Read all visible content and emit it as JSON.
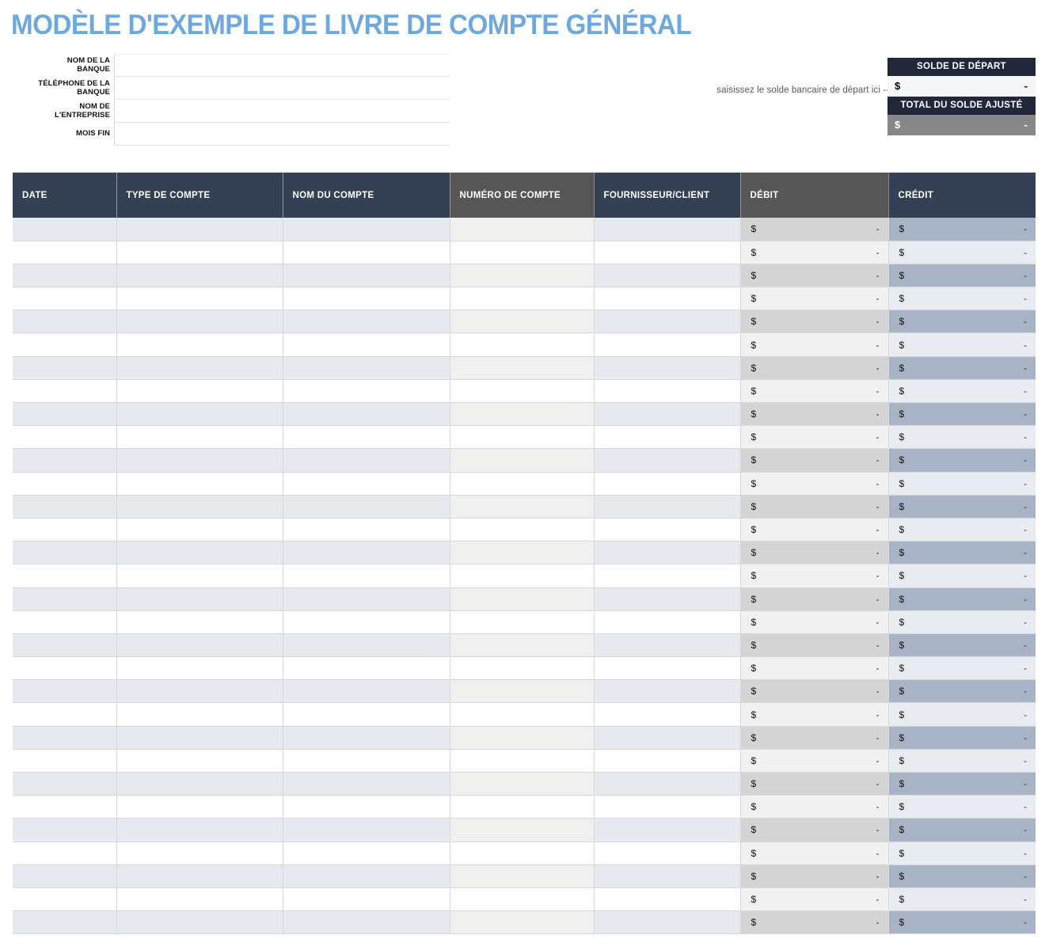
{
  "title": "MODÈLE D'EXEMPLE DE LIVRE DE COMPTE GÉNÉRAL",
  "colors": {
    "title_blue": "#6FA8DC",
    "header_navy": "#344154",
    "header_grey": "#565656",
    "balance_navy": "#22283a",
    "credit_shade": "#a8b4c6",
    "debit_shade": "#d4d4d4",
    "row_shade": "#e6eaef"
  },
  "form": {
    "fields": [
      {
        "label_line1": "NOM DE LA",
        "label_line2": "BANQUE",
        "value": "",
        "placeholder": ""
      },
      {
        "label_line1": "TÉLÉPHONE DE LA",
        "label_line2": "BANQUE",
        "value": "",
        "placeholder": ""
      },
      {
        "label_line1": "NOM DE",
        "label_line2": "L'ENTREPRISE",
        "value": "",
        "placeholder": ""
      },
      {
        "label_line1": "MOIS FIN",
        "label_line2": "",
        "value": "",
        "placeholder": ""
      }
    ]
  },
  "balance": {
    "note": "saisissez le solde bancaire de départ ici -->",
    "starting_label": "SOLDE DE DÉPART",
    "starting_currency": "$",
    "starting_value": "-",
    "adjusted_label": "TOTAL DU SOLDE AJUSTÉ",
    "adjusted_currency": "$",
    "adjusted_value": "-"
  },
  "table": {
    "columns": [
      {
        "label": "DATE",
        "style": "navy",
        "type": "plain"
      },
      {
        "label": "TYPE DE COMPTE",
        "style": "navy",
        "type": "plain"
      },
      {
        "label": "NOM DU COMPTE",
        "style": "navy",
        "type": "plain"
      },
      {
        "label": "NUMÉRO DE COMPTE",
        "style": "grey",
        "type": "acctnum"
      },
      {
        "label": "FOURNISSEUR/CLIENT",
        "style": "navy",
        "type": "plain"
      },
      {
        "label": "DÉBIT",
        "style": "grey",
        "type": "debit"
      },
      {
        "label": "CRÉDIT",
        "style": "navy",
        "type": "credit"
      }
    ],
    "row_count": 31,
    "currency_symbol": "$",
    "empty_value": "-",
    "rows": [
      {
        "date": "",
        "account_type": "",
        "account_name": "",
        "account_number": "",
        "vendor_customer": "",
        "debit": "-",
        "credit": "-"
      },
      {
        "date": "",
        "account_type": "",
        "account_name": "",
        "account_number": "",
        "vendor_customer": "",
        "debit": "-",
        "credit": "-"
      },
      {
        "date": "",
        "account_type": "",
        "account_name": "",
        "account_number": "",
        "vendor_customer": "",
        "debit": "-",
        "credit": "-"
      },
      {
        "date": "",
        "account_type": "",
        "account_name": "",
        "account_number": "",
        "vendor_customer": "",
        "debit": "-",
        "credit": "-"
      },
      {
        "date": "",
        "account_type": "",
        "account_name": "",
        "account_number": "",
        "vendor_customer": "",
        "debit": "-",
        "credit": "-"
      },
      {
        "date": "",
        "account_type": "",
        "account_name": "",
        "account_number": "",
        "vendor_customer": "",
        "debit": "-",
        "credit": "-"
      },
      {
        "date": "",
        "account_type": "",
        "account_name": "",
        "account_number": "",
        "vendor_customer": "",
        "debit": "-",
        "credit": "-"
      },
      {
        "date": "",
        "account_type": "",
        "account_name": "",
        "account_number": "",
        "vendor_customer": "",
        "debit": "-",
        "credit": "-"
      },
      {
        "date": "",
        "account_type": "",
        "account_name": "",
        "account_number": "",
        "vendor_customer": "",
        "debit": "-",
        "credit": "-"
      },
      {
        "date": "",
        "account_type": "",
        "account_name": "",
        "account_number": "",
        "vendor_customer": "",
        "debit": "-",
        "credit": "-"
      },
      {
        "date": "",
        "account_type": "",
        "account_name": "",
        "account_number": "",
        "vendor_customer": "",
        "debit": "-",
        "credit": "-"
      },
      {
        "date": "",
        "account_type": "",
        "account_name": "",
        "account_number": "",
        "vendor_customer": "",
        "debit": "-",
        "credit": "-"
      },
      {
        "date": "",
        "account_type": "",
        "account_name": "",
        "account_number": "",
        "vendor_customer": "",
        "debit": "-",
        "credit": "-"
      },
      {
        "date": "",
        "account_type": "",
        "account_name": "",
        "account_number": "",
        "vendor_customer": "",
        "debit": "-",
        "credit": "-"
      },
      {
        "date": "",
        "account_type": "",
        "account_name": "",
        "account_number": "",
        "vendor_customer": "",
        "debit": "-",
        "credit": "-"
      },
      {
        "date": "",
        "account_type": "",
        "account_name": "",
        "account_number": "",
        "vendor_customer": "",
        "debit": "-",
        "credit": "-"
      },
      {
        "date": "",
        "account_type": "",
        "account_name": "",
        "account_number": "",
        "vendor_customer": "",
        "debit": "-",
        "credit": "-"
      },
      {
        "date": "",
        "account_type": "",
        "account_name": "",
        "account_number": "",
        "vendor_customer": "",
        "debit": "-",
        "credit": "-"
      },
      {
        "date": "",
        "account_type": "",
        "account_name": "",
        "account_number": "",
        "vendor_customer": "",
        "debit": "-",
        "credit": "-"
      },
      {
        "date": "",
        "account_type": "",
        "account_name": "",
        "account_number": "",
        "vendor_customer": "",
        "debit": "-",
        "credit": "-"
      },
      {
        "date": "",
        "account_type": "",
        "account_name": "",
        "account_number": "",
        "vendor_customer": "",
        "debit": "-",
        "credit": "-"
      },
      {
        "date": "",
        "account_type": "",
        "account_name": "",
        "account_number": "",
        "vendor_customer": "",
        "debit": "-",
        "credit": "-"
      },
      {
        "date": "",
        "account_type": "",
        "account_name": "",
        "account_number": "",
        "vendor_customer": "",
        "debit": "-",
        "credit": "-"
      },
      {
        "date": "",
        "account_type": "",
        "account_name": "",
        "account_number": "",
        "vendor_customer": "",
        "debit": "-",
        "credit": "-"
      },
      {
        "date": "",
        "account_type": "",
        "account_name": "",
        "account_number": "",
        "vendor_customer": "",
        "debit": "-",
        "credit": "-"
      },
      {
        "date": "",
        "account_type": "",
        "account_name": "",
        "account_number": "",
        "vendor_customer": "",
        "debit": "-",
        "credit": "-"
      },
      {
        "date": "",
        "account_type": "",
        "account_name": "",
        "account_number": "",
        "vendor_customer": "",
        "debit": "-",
        "credit": "-"
      },
      {
        "date": "",
        "account_type": "",
        "account_name": "",
        "account_number": "",
        "vendor_customer": "",
        "debit": "-",
        "credit": "-"
      },
      {
        "date": "",
        "account_type": "",
        "account_name": "",
        "account_number": "",
        "vendor_customer": "",
        "debit": "-",
        "credit": "-"
      },
      {
        "date": "",
        "account_type": "",
        "account_name": "",
        "account_number": "",
        "vendor_customer": "",
        "debit": "-",
        "credit": "-"
      },
      {
        "date": "",
        "account_type": "",
        "account_name": "",
        "account_number": "",
        "vendor_customer": "",
        "debit": "-",
        "credit": "-"
      }
    ]
  }
}
